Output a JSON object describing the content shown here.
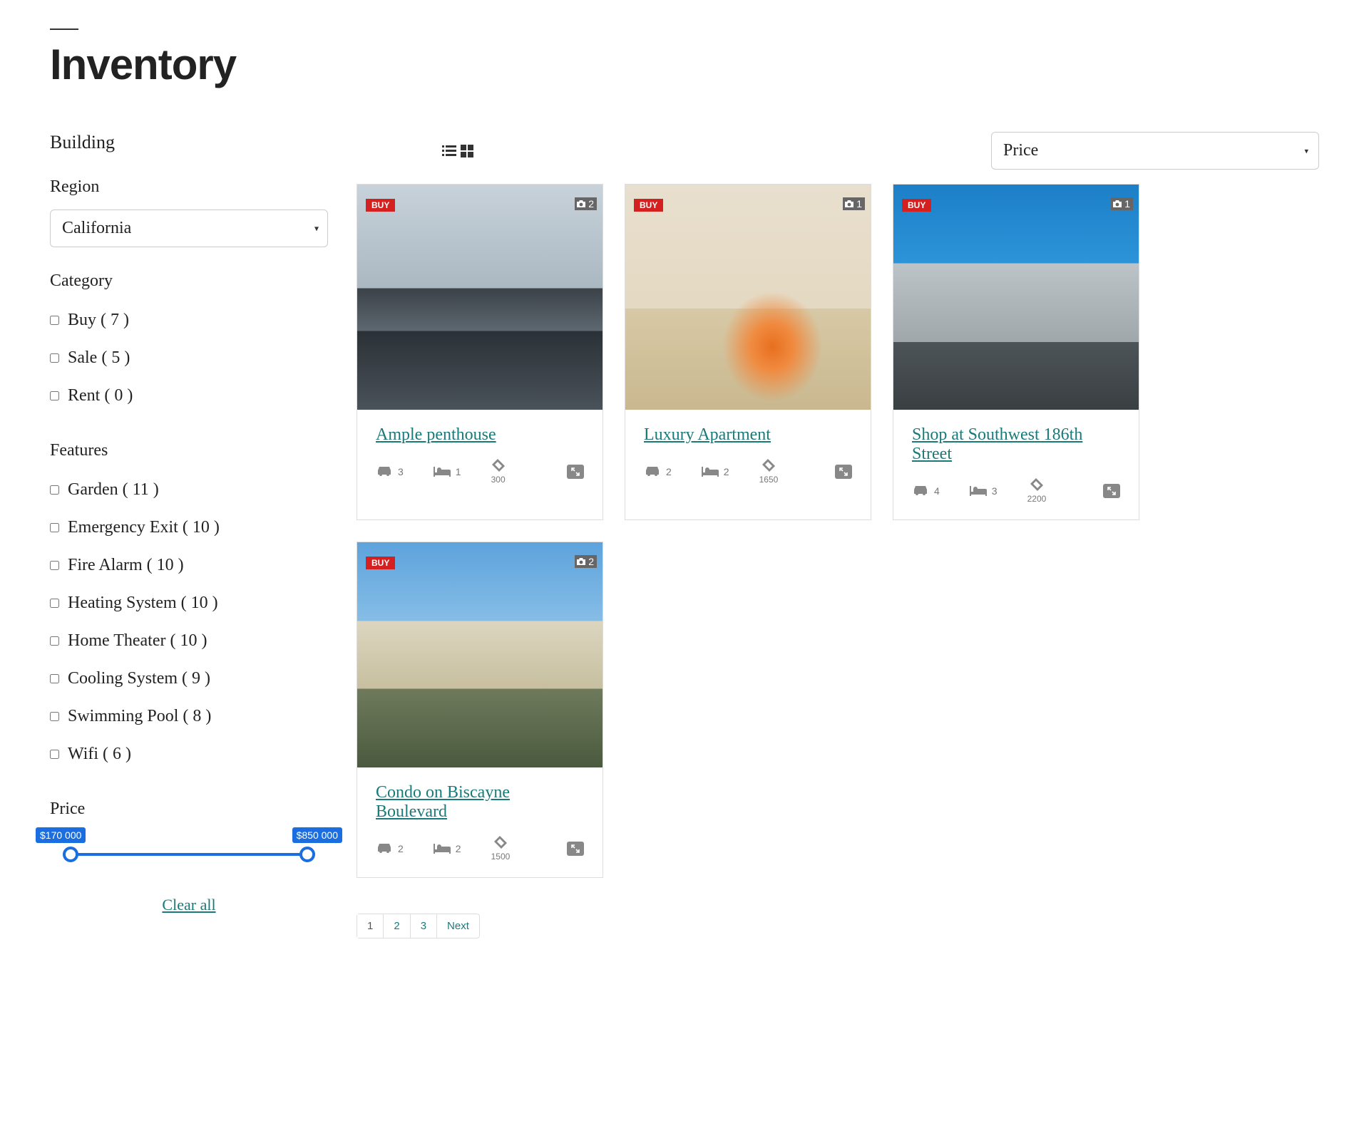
{
  "page": {
    "title": "Inventory"
  },
  "sidebar": {
    "building_label": "Building",
    "region_label": "Region",
    "region_selected": "California",
    "category_label": "Category",
    "categories": [
      {
        "label": "Buy ( 7 )"
      },
      {
        "label": "Sale ( 5 )"
      },
      {
        "label": "Rent ( 0 )"
      }
    ],
    "features_label": "Features",
    "features": [
      {
        "label": "Garden ( 11 )"
      },
      {
        "label": "Emergency Exit ( 10 )"
      },
      {
        "label": "Fire Alarm ( 10 )"
      },
      {
        "label": "Heating System ( 10 )"
      },
      {
        "label": "Home Theater ( 10 )"
      },
      {
        "label": "Cooling System ( 9 )"
      },
      {
        "label": "Swimming Pool ( 8 )"
      },
      {
        "label": "Wifi ( 6 )"
      }
    ],
    "price_label": "Price",
    "price_min": "$170 000",
    "price_max": "$850 000",
    "clear_all": "Clear all"
  },
  "listing_header": {
    "sort_selected": "Price"
  },
  "listings": [
    {
      "badge": "BUY",
      "photos": "2",
      "title": "Ample penthouse",
      "cars": "3",
      "beds": "1",
      "area": "300"
    },
    {
      "badge": "BUY",
      "photos": "1",
      "title": "Luxury Apartment",
      "cars": "2",
      "beds": "2",
      "area": "1650"
    },
    {
      "badge": "BUY",
      "photos": "1",
      "title": "Shop at Southwest 186th Street",
      "cars": "4",
      "beds": "3",
      "area": "2200"
    },
    {
      "badge": "BUY",
      "photos": "2",
      "title": "Condo on Biscayne Boulevard",
      "cars": "2",
      "beds": "2",
      "area": "1500"
    }
  ],
  "pagination": {
    "pages": [
      "1",
      "2",
      "3"
    ],
    "next": "Next"
  }
}
